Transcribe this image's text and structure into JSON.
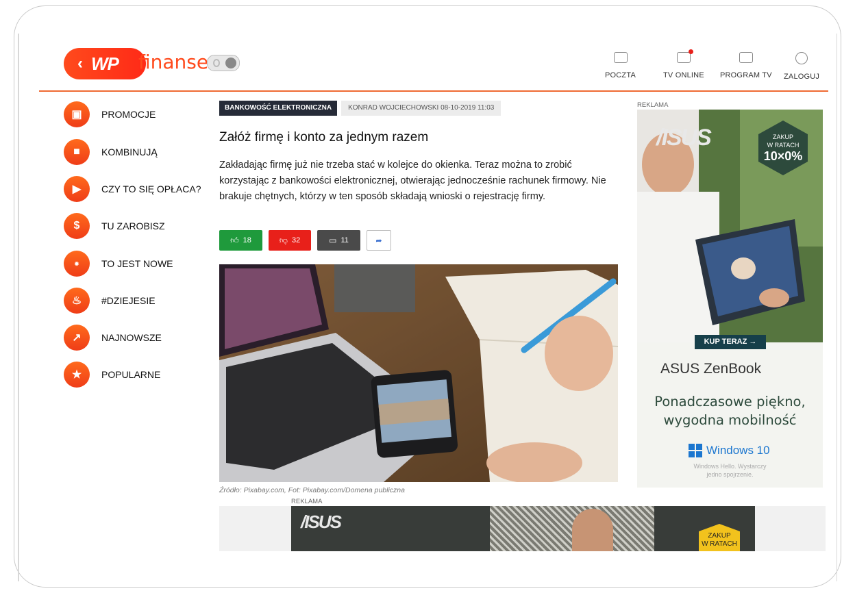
{
  "header": {
    "logo_back": "‹",
    "logo_wp": "WP",
    "logo_text": "finanse",
    "nav": [
      {
        "label": "POCZTA",
        "icon": "mail-icon"
      },
      {
        "label": "TV ONLINE",
        "icon": "tv-online-icon"
      },
      {
        "label": "PROGRAM TV",
        "icon": "tv-program-icon"
      },
      {
        "label": "ZALOGUJ",
        "icon": "user-login-icon"
      }
    ]
  },
  "sidebar": {
    "items": [
      {
        "label": "PROMOCJE",
        "icon": "wallet-icon"
      },
      {
        "label": "KOMBINUJĄ",
        "icon": "film-camera-icon"
      },
      {
        "label": "CZY TO SIĘ OPŁACA?",
        "icon": "play-icon"
      },
      {
        "label": "TU ZAROBISZ",
        "icon": "dollar-icon"
      },
      {
        "label": "TO JEST NOWE",
        "icon": "new-badge-icon"
      },
      {
        "label": "#DZIEJESIE",
        "icon": "fire-icon"
      },
      {
        "label": "NAJNOWSZE",
        "icon": "trending-up-icon"
      },
      {
        "label": "POPULARNE",
        "icon": "star-icon"
      }
    ]
  },
  "article": {
    "category": "BANKOWOŚĆ ELEKTRONICZNA",
    "meta": "KONRAD WOJCIECHOWSKI  08-10-2019 11:03",
    "title": "Załóż firmę i konto za jednym razem",
    "lead": "Zakładając firmę już nie trzeba stać w kolejce do okienka. Teraz można to zrobić korzystając z bankowości elektronicznej, otwierając jednocześnie rachunek firmowy. Nie brakuje chętnych, którzy w ten sposób składają wnioski o rejestrację firmy.",
    "reactions": {
      "likes": "18",
      "dislikes": "32",
      "comments": "11"
    },
    "caption": "Źródło: Pixabay.com, Fot: Pixabay.com/Domena publiczna"
  },
  "ads": {
    "label": "REKLAMA",
    "right": {
      "logo": "/ISUS",
      "badge_small": "ZAKUP\nW RATACH",
      "badge_big": "10×0%",
      "cta": "KUP TERAZ →",
      "brand": "ASUS ZenBook",
      "tagline_1": "Ponadczasowe piękno,",
      "tagline_2": "wygodna mobilność",
      "windows": "Windows 10",
      "fine_1": "Windows Hello. Wystarczy",
      "fine_2": "jedno spojrzenie."
    },
    "bottom": {
      "logo": "/ISUS",
      "badge": "ZAKUP\nW RATACH"
    }
  },
  "colors": {
    "brand": "#ff4a1c",
    "like": "#1f9a3c",
    "dislike": "#e8201a",
    "comment": "#4a4a4a"
  }
}
